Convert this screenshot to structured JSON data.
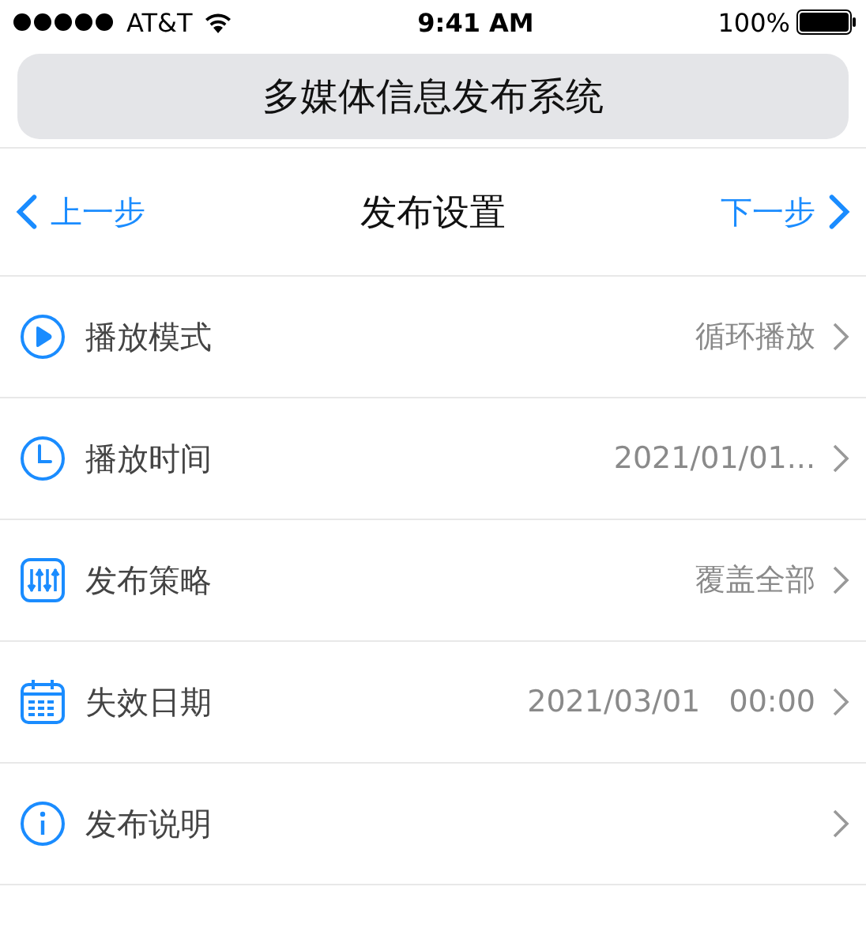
{
  "status_bar": {
    "carrier": "AT&T",
    "time": "9:41 AM",
    "battery": "100%"
  },
  "app_title": "多媒体信息发布系统",
  "nav": {
    "back": "上一步",
    "title": "发布设置",
    "next": "下一步"
  },
  "rows": [
    {
      "label": "播放模式",
      "value": "循环播放"
    },
    {
      "label": "播放时间",
      "value": "2021/01/01..."
    },
    {
      "label": "发布策略",
      "value": "覆盖全部"
    },
    {
      "label": "失效日期",
      "value": "2021/03/01   00:00"
    },
    {
      "label": "发布说明"
    }
  ]
}
